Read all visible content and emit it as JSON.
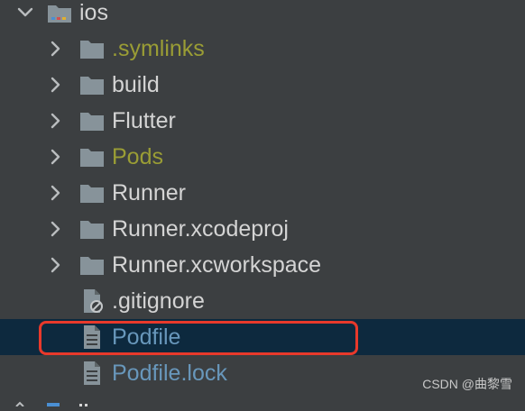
{
  "project_tree": {
    "root": {
      "label": "ios",
      "expanded": true,
      "icon": "module-folder-icon"
    },
    "items": [
      {
        "label": ".symlinks",
        "type": "folder",
        "style": "ignored"
      },
      {
        "label": "build",
        "type": "folder",
        "style": "normal"
      },
      {
        "label": "Flutter",
        "type": "folder",
        "style": "normal"
      },
      {
        "label": "Pods",
        "type": "folder",
        "style": "ignored"
      },
      {
        "label": "Runner",
        "type": "folder",
        "style": "normal"
      },
      {
        "label": "Runner.xcodeproj",
        "type": "folder",
        "style": "normal"
      },
      {
        "label": "Runner.xcworkspace",
        "type": "folder",
        "style": "normal"
      },
      {
        "label": ".gitignore",
        "type": "file",
        "style": "normal"
      },
      {
        "label": "Podfile",
        "type": "file",
        "style": "vcs",
        "selected": true
      },
      {
        "label": "Podfile.lock",
        "type": "file",
        "style": "vcs"
      }
    ]
  },
  "watermark": "CSDN @曲黎雪",
  "colors": {
    "background": "#3c3f41",
    "selection": "#0d293e",
    "text": "#d4d4d4",
    "ignored_text": "#9a9d35",
    "vcs_text": "#6897bb",
    "highlight_border": "#e8392b"
  }
}
